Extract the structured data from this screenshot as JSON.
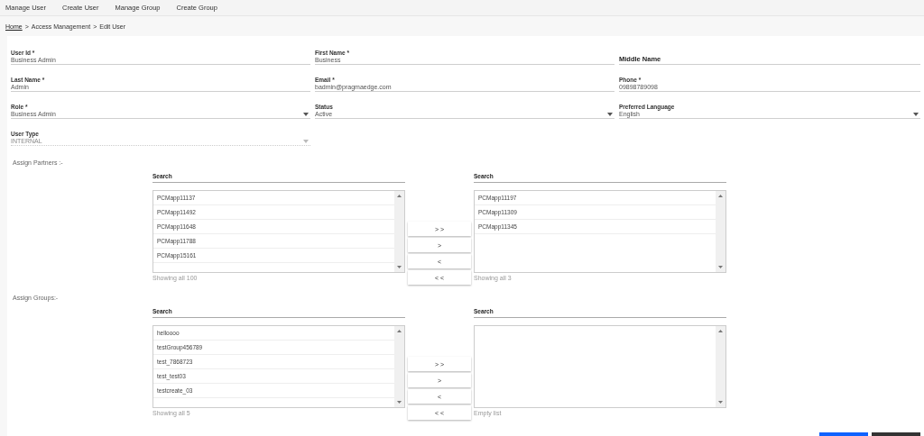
{
  "nav": [
    "Manage User",
    "Create User",
    "Manage Group",
    "Create Group"
  ],
  "breadcrumb": {
    "links": [
      "Home"
    ],
    "items": [
      "Access Management",
      "Edit User"
    ],
    "separator": ">"
  },
  "fields": [
    {
      "kind": "text",
      "label": "User Id *",
      "value": "Business Admin",
      "disabled": false
    },
    {
      "kind": "text",
      "label": "First Name *",
      "value": "Business",
      "disabled": false
    },
    {
      "kind": "text",
      "placeholder": "Middle Name",
      "disabled": false
    },
    {
      "kind": "text",
      "label": "Last Name *",
      "value": "Admin",
      "disabled": false
    },
    {
      "kind": "text",
      "label": "Email *",
      "value": "badmin@pragmaedge.com",
      "disabled": false
    },
    {
      "kind": "text",
      "label": "Phone *",
      "value": "09898789098",
      "disabled": false
    },
    {
      "kind": "select",
      "label": "Role *",
      "value": "Business Admin",
      "disabled": false
    },
    {
      "kind": "select",
      "label": "Status",
      "value": "Active",
      "disabled": false
    },
    {
      "kind": "select",
      "label": "Preferred Language",
      "value": "English",
      "disabled": false
    },
    {
      "kind": "select",
      "label": "User Type",
      "value": "INTERNAL",
      "disabled": true
    }
  ],
  "assign": [
    {
      "title": "Assign Partners :-",
      "left": {
        "search_label": "Search",
        "items": [
          "PCMapp11137",
          "PCMapp11492",
          "PCMapp11648",
          "PCMapp11788",
          "PCMapp15161"
        ],
        "footer": "Showing all 100"
      },
      "buttons": [
        "> >",
        ">",
        "<",
        "< <"
      ],
      "right": {
        "search_label": "Search",
        "items": [
          "PCMapp11197",
          "PCMapp11309",
          "PCMapp11345"
        ],
        "footer": "Showing all 3"
      }
    },
    {
      "title": "Assign Groups:-",
      "left": {
        "search_label": "Search",
        "items": [
          "helloooo",
          "testGroup456789",
          "test_7868723",
          "test_test03",
          "testcreate_03"
        ],
        "footer": "Showing all 5"
      },
      "buttons": [
        "> >",
        ">",
        "<",
        "< <"
      ],
      "right": {
        "search_label": "Search",
        "footer": "Empty list"
      }
    }
  ]
}
